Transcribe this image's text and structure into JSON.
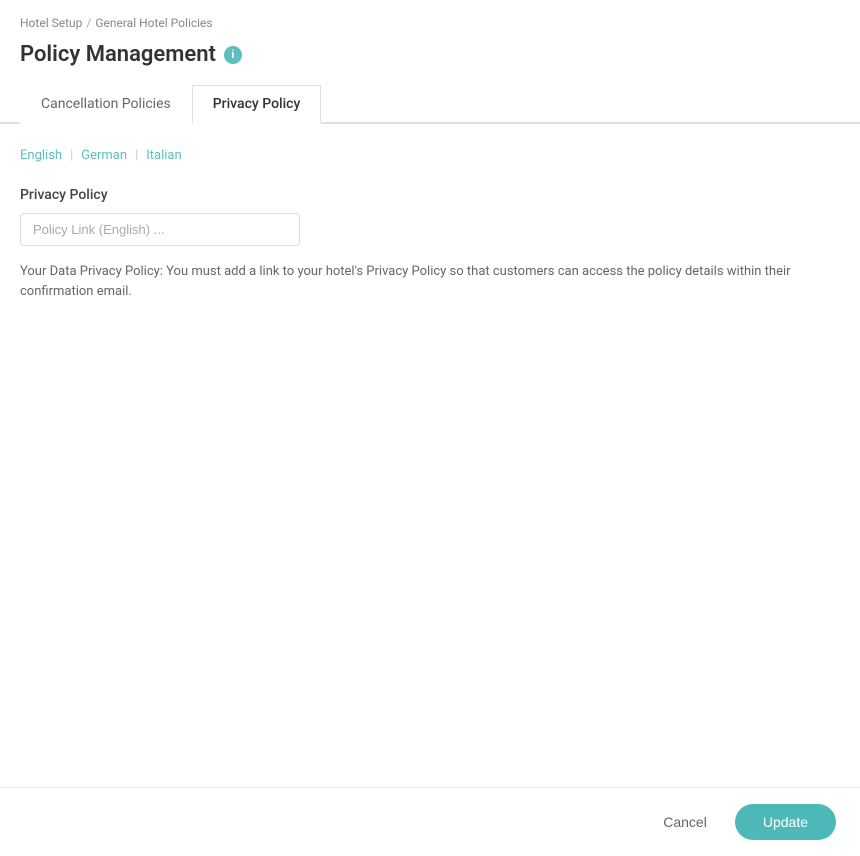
{
  "breadcrumb": {
    "parent": "Hotel Setup",
    "separator": "/",
    "current": "General Hotel Policies"
  },
  "page": {
    "title": "Policy Management",
    "info_icon": "i"
  },
  "tabs": [
    {
      "id": "cancellation",
      "label": "Cancellation Policies",
      "active": false
    },
    {
      "id": "privacy",
      "label": "Privacy Policy",
      "active": true
    }
  ],
  "languages": [
    {
      "id": "english",
      "label": "English",
      "active": true
    },
    {
      "id": "german",
      "label": "German",
      "active": false
    },
    {
      "id": "italian",
      "label": "Italian",
      "active": false
    }
  ],
  "privacy_section": {
    "label": "Privacy Policy",
    "input_placeholder": "Policy Link (English) ...",
    "input_value": "",
    "info_text": "Your Data Privacy Policy: You must add a link to your hotel's Privacy Policy so that customers can access the policy details within their confirmation email."
  },
  "footer": {
    "cancel_label": "Cancel",
    "update_label": "Update"
  }
}
